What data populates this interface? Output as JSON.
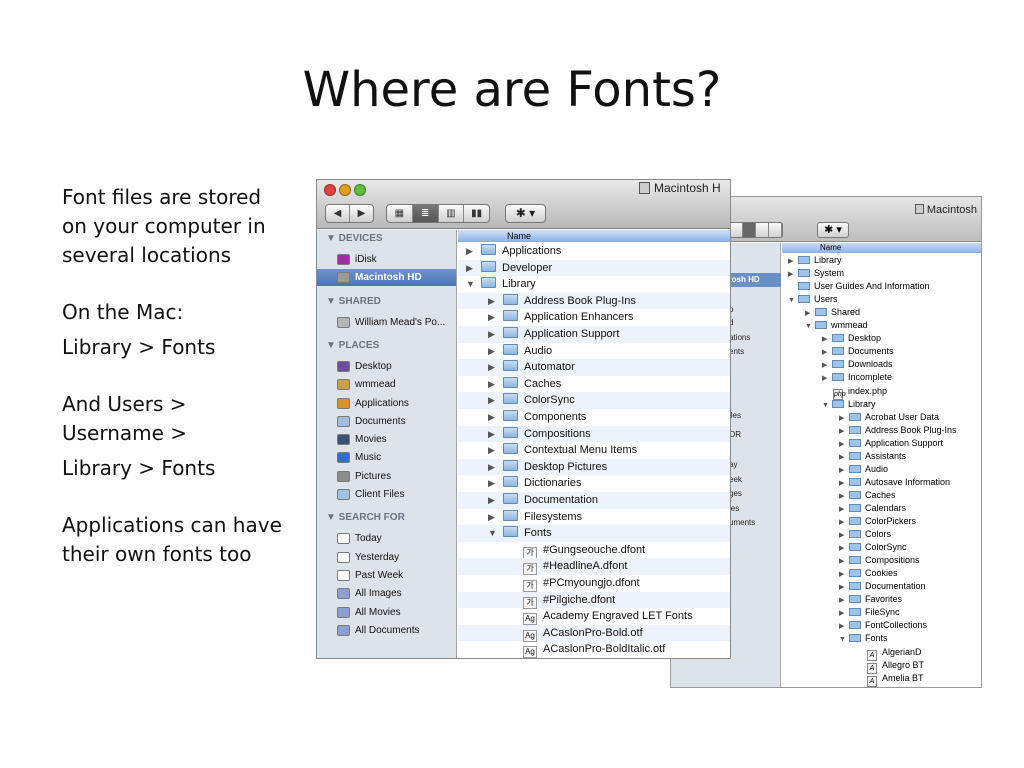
{
  "slide": {
    "title": "Where are Fonts?",
    "bullets": [
      "Font files are stored on your computer in several locations",
      "On the Mac:",
      "Library > Fonts",
      "And Users > Username >",
      "Library > Fonts",
      "Applications can have their own fonts too"
    ]
  },
  "front_window": {
    "title": "Macintosh H",
    "nav_back": "◀",
    "nav_forward": "▶",
    "view_icons": "▦",
    "view_list": "≣",
    "view_columns": "▥",
    "view_coverflow": "▮▮",
    "gear": "✱ ▾",
    "column_header": "Name",
    "sidebar": {
      "devices_header": "▼ DEVICES",
      "shared_header": "▼ SHARED",
      "places_header": "▼ PLACES",
      "search_header": "▼ SEARCH FOR",
      "devices": [
        {
          "label": "iDisk",
          "color": "#a52aa5"
        },
        {
          "label": "Macintosh HD",
          "color": "#9a9a9a"
        }
      ],
      "shared": [
        {
          "label": "William Mead's Po...",
          "color": "#b5b5b5"
        }
      ],
      "places": [
        {
          "label": "Desktop",
          "color": "#6a4f9e"
        },
        {
          "label": "wmmead",
          "color": "#caa14a"
        },
        {
          "label": "Applications",
          "color": "#d8912f"
        },
        {
          "label": "Documents",
          "color": "#9fbde3"
        },
        {
          "label": "Movies",
          "color": "#3b4f79"
        },
        {
          "label": "Music",
          "color": "#2f6fc6"
        },
        {
          "label": "Pictures",
          "color": "#8c8c8c"
        },
        {
          "label": "Client Files",
          "color": "#9ec2e8"
        }
      ],
      "search": [
        {
          "label": "Today",
          "color": "#ffffff"
        },
        {
          "label": "Yesterday",
          "color": "#ffffff"
        },
        {
          "label": "Past Week",
          "color": "#ffffff"
        },
        {
          "label": "All Images",
          "color": "#8f9fd3"
        },
        {
          "label": "All Movies",
          "color": "#8f9fd3"
        },
        {
          "label": "All Documents",
          "color": "#8f9fd3"
        }
      ]
    },
    "rows": [
      {
        "label": "Applications",
        "tri": "▶",
        "level": 0
      },
      {
        "label": "Developer",
        "tri": "▶",
        "level": 0
      },
      {
        "label": "Library",
        "tri": "▼",
        "level": 0
      },
      {
        "label": "Address Book Plug-Ins",
        "tri": "▶",
        "level": 1
      },
      {
        "label": "Application Enhancers",
        "tri": "▶",
        "level": 1
      },
      {
        "label": "Application Support",
        "tri": "▶",
        "level": 1
      },
      {
        "label": "Audio",
        "tri": "▶",
        "level": 1
      },
      {
        "label": "Automator",
        "tri": "▶",
        "level": 1
      },
      {
        "label": "Caches",
        "tri": "▶",
        "level": 1
      },
      {
        "label": "ColorSync",
        "tri": "▶",
        "level": 1
      },
      {
        "label": "Components",
        "tri": "▶",
        "level": 1
      },
      {
        "label": "Compositions",
        "tri": "▶",
        "level": 1
      },
      {
        "label": "Contextual Menu Items",
        "tri": "▶",
        "level": 1
      },
      {
        "label": "Desktop Pictures",
        "tri": "▶",
        "level": 1
      },
      {
        "label": "Dictionaries",
        "tri": "▶",
        "level": 1
      },
      {
        "label": "Documentation",
        "tri": "▶",
        "level": 1
      },
      {
        "label": "Filesystems",
        "tri": "▶",
        "level": 1
      },
      {
        "label": "Fonts",
        "tri": "▼",
        "level": 1
      },
      {
        "label": "#Gungseouche.dfont",
        "tri": "",
        "level": 2,
        "file": "가"
      },
      {
        "label": "#HeadlineA.dfont",
        "tri": "",
        "level": 2,
        "file": "가"
      },
      {
        "label": "#PCmyoungjo.dfont",
        "tri": "",
        "level": 2,
        "file": "가"
      },
      {
        "label": "#Pilgiche.dfont",
        "tri": "",
        "level": 2,
        "file": "가"
      },
      {
        "label": "Academy Engraved LET Fonts",
        "tri": "",
        "level": 2,
        "file": "Ag"
      },
      {
        "label": "ACaslonPro-Bold.otf",
        "tri": "",
        "level": 2,
        "file": "Ag"
      },
      {
        "label": "ACaslonPro-BoldItalic.otf",
        "tri": "",
        "level": 2,
        "file": "Ag"
      }
    ]
  },
  "back_window": {
    "title": "Macintosh",
    "gear": "✱ ▾",
    "column_header": "Name",
    "sidebar": [
      {
        "label": "tosh HD",
        "selected": true
      },
      {
        "label": "p",
        "selected": false
      },
      {
        "label": "d",
        "selected": false
      },
      {
        "label": "ations",
        "selected": false
      },
      {
        "label": "ents",
        "selected": false
      },
      {
        "label": "iles",
        "selected": false
      },
      {
        "label": "OR",
        "selected": false
      },
      {
        "label": "ay",
        "selected": false
      },
      {
        "label": "eek",
        "selected": false
      },
      {
        "label": "ges",
        "selected": false
      },
      {
        "label": "ies",
        "selected": false
      },
      {
        "label": "uments",
        "selected": false
      }
    ],
    "rows": [
      {
        "label": "Library",
        "tri": "▶",
        "level": 0
      },
      {
        "label": "System",
        "tri": "▶",
        "level": 0
      },
      {
        "label": "User Guides And Information",
        "tri": "",
        "level": 0
      },
      {
        "label": "Users",
        "tri": "▼",
        "level": 0
      },
      {
        "label": "Shared",
        "tri": "▶",
        "level": 1
      },
      {
        "label": "wmmead",
        "tri": "▼",
        "level": 1
      },
      {
        "label": "Desktop",
        "tri": "▶",
        "level": 2
      },
      {
        "label": "Documents",
        "tri": "▶",
        "level": 2
      },
      {
        "label": "Downloads",
        "tri": "▶",
        "level": 2
      },
      {
        "label": "Incomplete",
        "tri": "▶",
        "level": 2
      },
      {
        "label": "index.php",
        "tri": "",
        "level": 2,
        "file": "php"
      },
      {
        "label": "Library",
        "tri": "▼",
        "level": 2
      },
      {
        "label": "Acrobat User Data",
        "tri": "▶",
        "level": 3
      },
      {
        "label": "Address Book Plug-Ins",
        "tri": "▶",
        "level": 3
      },
      {
        "label": "Application Support",
        "tri": "▶",
        "level": 3
      },
      {
        "label": "Assistants",
        "tri": "▶",
        "level": 3
      },
      {
        "label": "Audio",
        "tri": "▶",
        "level": 3
      },
      {
        "label": "Autosave Information",
        "tri": "▶",
        "level": 3
      },
      {
        "label": "Caches",
        "tri": "▶",
        "level": 3
      },
      {
        "label": "Calendars",
        "tri": "▶",
        "level": 3
      },
      {
        "label": "ColorPickers",
        "tri": "▶",
        "level": 3
      },
      {
        "label": "Colors",
        "tri": "▶",
        "level": 3
      },
      {
        "label": "ColorSync",
        "tri": "▶",
        "level": 3
      },
      {
        "label": "Compositions",
        "tri": "▶",
        "level": 3
      },
      {
        "label": "Cookies",
        "tri": "▶",
        "level": 3
      },
      {
        "label": "Documentation",
        "tri": "▶",
        "level": 3
      },
      {
        "label": "Favorites",
        "tri": "▶",
        "level": 3
      },
      {
        "label": "FileSync",
        "tri": "▶",
        "level": 3
      },
      {
        "label": "FontCollections",
        "tri": "▶",
        "level": 3
      },
      {
        "label": "Fonts",
        "tri": "▼",
        "level": 3
      },
      {
        "label": "AlgerianD",
        "tri": "",
        "level": 4,
        "file": "A"
      },
      {
        "label": "Allegro BT",
        "tri": "",
        "level": 4,
        "file": "A"
      },
      {
        "label": "Amelia BT",
        "tri": "",
        "level": 4,
        "file": "A"
      }
    ]
  }
}
